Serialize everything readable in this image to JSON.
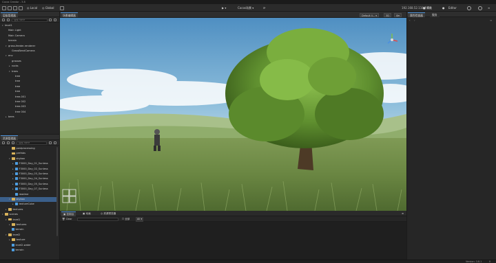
{
  "titlebar": {
    "title": "Cocos Creator - 3.8"
  },
  "toolbar": {
    "local_label": "Local",
    "global_label": "Global",
    "device_label": "Cocos场景",
    "ip_label": "192.168.52.118:7456",
    "preview_label": "预览",
    "editor_label": "Editor"
  },
  "hierarchy": {
    "tab_label": "层级管理器",
    "search_placeholder": "搜索 name",
    "items": [
      {
        "label": "level1",
        "indent": 0,
        "arrow": "▾",
        "type": "node"
      },
      {
        "label": "Main Light",
        "indent": 1,
        "arrow": "",
        "type": "node"
      },
      {
        "label": "Main Camera",
        "indent": 1,
        "arrow": "",
        "type": "node"
      },
      {
        "label": "terrain",
        "indent": 1,
        "arrow": "",
        "type": "node"
      },
      {
        "label": "grass-feeder-renderer",
        "indent": 1,
        "arrow": "▾",
        "type": "node"
      },
      {
        "label": "GrassBendCamera",
        "indent": 2,
        "arrow": "",
        "type": "node"
      },
      {
        "label": "env",
        "indent": 1,
        "arrow": "▾",
        "type": "node"
      },
      {
        "label": "grasses",
        "indent": 2,
        "arrow": "",
        "type": "node"
      },
      {
        "label": "rocks",
        "indent": 2,
        "arrow": "▸",
        "type": "node"
      },
      {
        "label": "trees",
        "indent": 2,
        "arrow": "▾",
        "type": "node"
      },
      {
        "label": "tree",
        "indent": 3,
        "arrow": "",
        "type": "node"
      },
      {
        "label": "tree",
        "indent": 3,
        "arrow": "",
        "type": "node"
      },
      {
        "label": "tree",
        "indent": 3,
        "arrow": "",
        "type": "node"
      },
      {
        "label": "tree",
        "indent": 3,
        "arrow": "",
        "type": "node"
      },
      {
        "label": "tree-001",
        "indent": 3,
        "arrow": "",
        "type": "node"
      },
      {
        "label": "tree 002",
        "indent": 3,
        "arrow": "",
        "type": "node"
      },
      {
        "label": "tree-003",
        "indent": 3,
        "arrow": "",
        "type": "node"
      },
      {
        "label": "tree 004",
        "indent": 3,
        "arrow": "",
        "type": "node"
      },
      {
        "label": "bees",
        "indent": 1,
        "arrow": "▸",
        "type": "node"
      }
    ]
  },
  "assets": {
    "tab_label": "资源管理器",
    "search_placeholder": "搜索 name",
    "items": [
      {
        "label": "postprocessing",
        "indent": 2,
        "arrow": "",
        "type": "folder"
      },
      {
        "label": "prefabs",
        "indent": 2,
        "arrow": "",
        "type": "folder"
      },
      {
        "label": "skybox",
        "indent": 2,
        "arrow": "▾",
        "type": "folder"
      },
      {
        "label": "F3000_Day_01_Sunless",
        "indent": 3,
        "arrow": "▸",
        "type": "asset"
      },
      {
        "label": "F3000_Day_02_Sunless",
        "indent": 3,
        "arrow": "▸",
        "type": "asset"
      },
      {
        "label": "F3000_Day_03_Sunless",
        "indent": 3,
        "arrow": "▸",
        "type": "asset"
      },
      {
        "label": "F3000_Day_04_Sunless",
        "indent": 3,
        "arrow": "▸",
        "type": "asset"
      },
      {
        "label": "F3000_Day_05_Sunless",
        "indent": 3,
        "arrow": "▸",
        "type": "asset"
      },
      {
        "label": "F3000_Day_07_Sunless",
        "indent": 3,
        "arrow": "▸",
        "type": "asset"
      },
      {
        "label": "readme",
        "indent": 3,
        "arrow": "",
        "type": "asset"
      },
      {
        "label": "skybox",
        "indent": 2,
        "arrow": "▾",
        "type": "folder",
        "selected": true
      },
      {
        "label": "textureCube",
        "indent": 3,
        "arrow": "▸",
        "type": "asset"
      },
      {
        "label": "textures",
        "indent": 1,
        "arrow": "▸",
        "type": "folder"
      },
      {
        "label": "scenes",
        "indent": 0,
        "arrow": "▾",
        "type": "folder"
      },
      {
        "label": "level1",
        "indent": 1,
        "arrow": "▾",
        "type": "folder"
      },
      {
        "label": "textures",
        "indent": 2,
        "arrow": "▸",
        "type": "folder"
      },
      {
        "label": "terrain",
        "indent": 2,
        "arrow": "",
        "type": "asset"
      },
      {
        "label": "level2",
        "indent": 1,
        "arrow": "▾",
        "type": "folder"
      },
      {
        "label": "texture",
        "indent": 2,
        "arrow": "▸",
        "type": "folder"
      },
      {
        "label": "level2-water",
        "indent": 2,
        "arrow": "",
        "type": "asset"
      },
      {
        "label": "terrain",
        "indent": 2,
        "arrow": "",
        "type": "asset"
      }
    ]
  },
  "scene": {
    "tab_label": "场景编辑器",
    "dropdown_label": "Default li...",
    "view_label": "3D"
  },
  "console": {
    "tabs": [
      "控制台",
      "动画",
      "资源预览器"
    ],
    "clear_label": "Clear",
    "filter_label": "全部",
    "level_label": "All"
  },
  "inspector": {
    "tabs": [
      "属性检查器",
      "服务"
    ]
  },
  "status": {
    "version": "Version: 3.8.1",
    "count": "0"
  },
  "colors": {
    "accent": "#4a8fd6",
    "folder": "#d8b25a",
    "asset": "#4d9de0",
    "selection": "#3b5f8a"
  }
}
